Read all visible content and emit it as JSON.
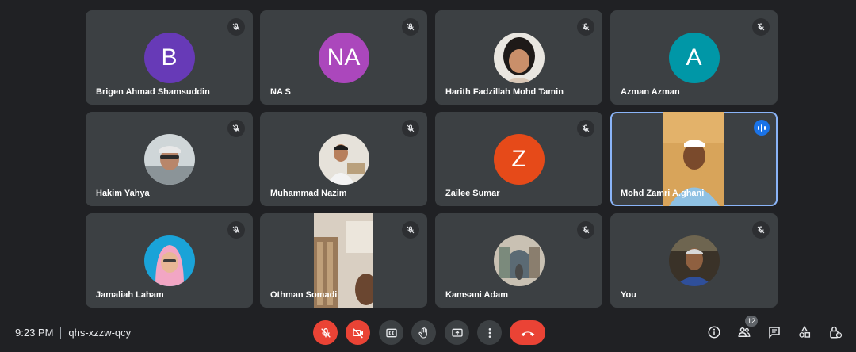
{
  "participants": [
    {
      "name": "Brigen Ahmad Shamsuddin",
      "initials": "B",
      "color": "#673ab7"
    },
    {
      "name": "NA S",
      "initials": "NA",
      "color": "#ab47bc"
    },
    {
      "name": "Harith Fadzillah Mohd Tamin"
    },
    {
      "name": "Azman Azman",
      "initials": "A",
      "color": "#0097a7"
    },
    {
      "name": "Hakim Yahya"
    },
    {
      "name": "Muhammad Nazim"
    },
    {
      "name": "Zailee Sumar",
      "initials": "Z",
      "color": "#e64a19"
    },
    {
      "name": "Mohd Zamri A.ghani",
      "speaking": true
    },
    {
      "name": "Jamaliah Laham"
    },
    {
      "name": "Othman Somadi"
    },
    {
      "name": "Kamsani Adam"
    },
    {
      "name": "You"
    }
  ],
  "meeting": {
    "time": "9:23 PM",
    "code": "qhs-xzzw-qcy"
  },
  "people_count": "12",
  "colors": {
    "background": "#202124",
    "tile": "#3c4043",
    "danger": "#ea4335",
    "speaking_accent": "#8ab4f8"
  }
}
